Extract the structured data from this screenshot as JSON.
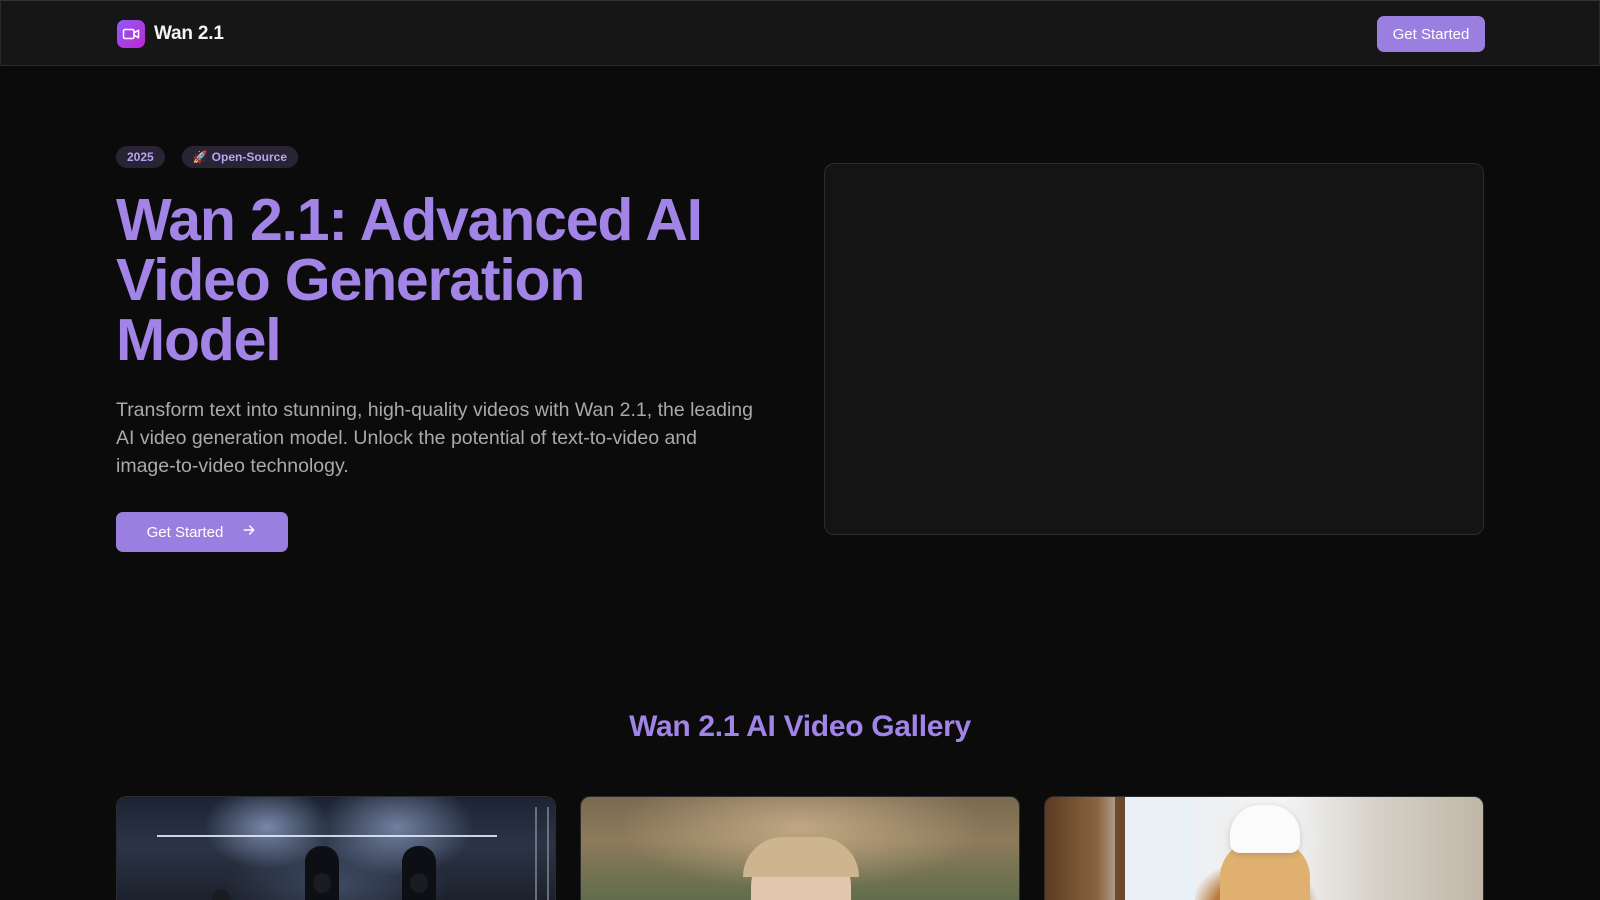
{
  "header": {
    "brand_name": "Wan 2.1",
    "logo_icon": "video-camera-icon",
    "cta_label": "Get Started"
  },
  "hero": {
    "badges": [
      {
        "label": "2025"
      },
      {
        "icon": "🚀",
        "label": "Open-Source"
      }
    ],
    "title": "Wan 2.1: Advanced AI Video Generation Model",
    "subtitle": "Transform text into stunning, high-quality videos with Wan 2.1, the leading AI video generation model. Unlock the potential of text-to-video and image-to-video technology.",
    "cta_label": "Get Started",
    "cta_icon": "arrow-right-icon"
  },
  "gallery": {
    "title": "Wan 2.1 AI Video Gallery",
    "items": [
      {
        "scene": "concert stage with performers"
      },
      {
        "scene": "portrait of blonde woman outdoors"
      },
      {
        "scene": "child chef in kitchen"
      }
    ]
  },
  "colors": {
    "background": "#0b0b0c",
    "header_bg": "#161617",
    "accent": "#9b7fe0",
    "heading": "#a283e6",
    "badge_bg": "#282436",
    "badge_text": "#b9a5ee",
    "body_text": "#a9a9ae"
  }
}
